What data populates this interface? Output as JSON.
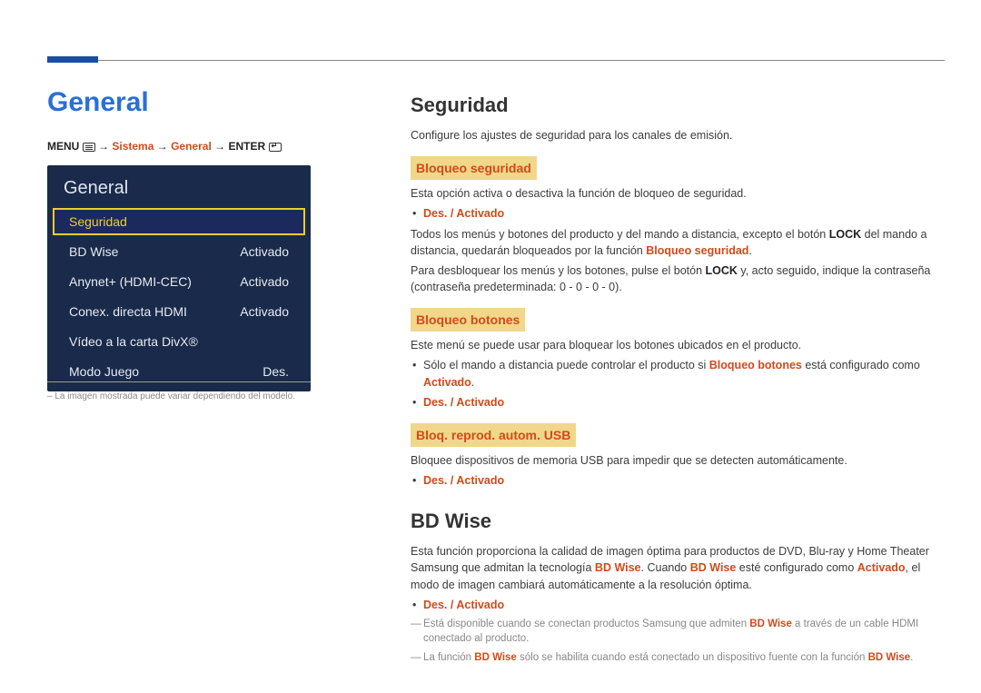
{
  "page_title": "General",
  "breadcrumb": {
    "menu": "MENU",
    "arrow": "→",
    "sistema": "Sistema",
    "general": "General",
    "enter": "ENTER"
  },
  "menu_panel": {
    "title": "General",
    "items": [
      {
        "label": "Seguridad",
        "value": "",
        "selected": true
      },
      {
        "label": "BD Wise",
        "value": "Activado"
      },
      {
        "label": "Anynet+ (HDMI-CEC)",
        "value": "Activado"
      },
      {
        "label": "Conex. directa HDMI",
        "value": "Activado"
      },
      {
        "label": "Vídeo a la carta DivX®",
        "value": ""
      },
      {
        "label": "Modo Juego",
        "value": "Des."
      }
    ]
  },
  "footnote": "La imagen mostrada puede variar dependiendo del modelo.",
  "content": {
    "seguridad": {
      "title": "Seguridad",
      "intro": "Configure los ajustes de seguridad para los canales de emisión.",
      "bloqueo_seguridad": {
        "heading": "Bloqueo seguridad",
        "p1": "Esta opción activa o desactiva la función de bloqueo de seguridad.",
        "opt": "Des. / Activado",
        "p2a": "Todos los menús y botones del producto y del mando a distancia, excepto el botón ",
        "p2b_bold": "LOCK",
        "p2c": " del mando a distancia, quedarán bloqueados por la función ",
        "p2d_kw": "Bloqueo seguridad",
        "p2e": ".",
        "p3a": "Para desbloquear los menús y los botones, pulse el botón ",
        "p3b_bold": "LOCK",
        "p3c": " y, acto seguido, indique la contraseña (contraseña predeterminada: 0 - 0 - 0 - 0)."
      },
      "bloqueo_botones": {
        "heading": "Bloqueo botones",
        "p1": "Este menú se puede usar para bloquear los botones ubicados en el producto.",
        "p2a": "Sólo el mando a distancia puede controlar el producto si ",
        "p2b_kw": "Bloqueo botones",
        "p2c": " está configurado como ",
        "p2d_kw": "Activado",
        "p2e": ".",
        "opt": "Des. / Activado"
      },
      "bloq_usb": {
        "heading": "Bloq. reprod. autom. USB",
        "p1": "Bloquee dispositivos de memoria USB para impedir que se detecten automáticamente.",
        "opt": "Des. / Activado"
      }
    },
    "bdwise": {
      "title": "BD Wise",
      "p1a": "Esta función proporciona la calidad de imagen óptima para productos de DVD, Blu-ray y Home Theater Samsung que admitan la tecnología ",
      "p1b_kw": "BD Wise",
      "p1c": ". Cuando ",
      "p1d_kw": "BD Wise",
      "p1e": " esté configurado como ",
      "p1f_kw": "Activado",
      "p1g": ", el modo de imagen cambiará automáticamente a la resolución óptima.",
      "opt": "Des. / Activado",
      "n1a": "Está disponible cuando se conectan productos Samsung que admiten ",
      "n1b_kw": "BD Wise",
      "n1c": " a través de un cable HDMI conectado al producto.",
      "n2a": "La función ",
      "n2b_kw": "BD Wise",
      "n2c": " sólo se habilita cuando está conectado un dispositivo fuente con la función ",
      "n2d_kw": "BD Wise",
      "n2e": "."
    }
  }
}
